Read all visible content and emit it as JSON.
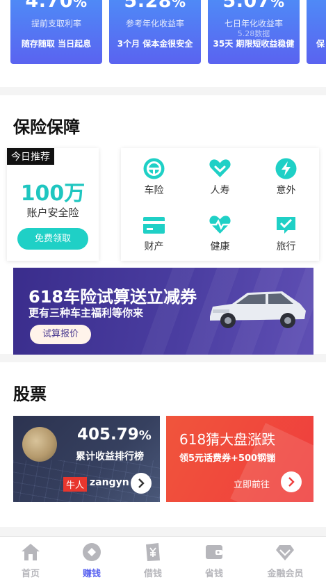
{
  "rates": [
    {
      "num": "4.70",
      "unit": "%",
      "label": "提前支取利率",
      "sub": "",
      "desc": "随存随取 当日起息"
    },
    {
      "num": "5.28",
      "unit": "%",
      "label": "参考年化收益率",
      "sub": "",
      "desc": "3个月 保本金很安全"
    },
    {
      "num": "5.07",
      "unit": "%",
      "label": "七日年化收益率",
      "sub": "5.28数据",
      "desc": "35天 期限短收益稳健"
    },
    {
      "num": "",
      "unit": "",
      "label": "",
      "sub": "",
      "desc": "保"
    }
  ],
  "insurance": {
    "title": "保险保障",
    "featured": {
      "tag": "今日推荐",
      "amount": "100万",
      "name": "账户安全险",
      "button": "免费领取"
    },
    "categories": [
      {
        "label": "车险",
        "icon": "steering-wheel-icon"
      },
      {
        "label": "人寿",
        "icon": "heart-icon"
      },
      {
        "label": "意外",
        "icon": "lightning-icon"
      },
      {
        "label": "财产",
        "icon": "card-icon"
      },
      {
        "label": "健康",
        "icon": "heart-pulse-icon"
      },
      {
        "label": "旅行",
        "icon": "check-flag-icon"
      }
    ],
    "banner": {
      "headline": "618车险试算送立减券",
      "subline": "更有三种车主福利等你来",
      "button": "试算报价"
    }
  },
  "stocks": {
    "title": "股票",
    "left": {
      "pct": "405.79",
      "unit": "%",
      "rank": "累计收益排行榜",
      "tag": "牛人",
      "user": "zangyn"
    },
    "right": {
      "title": "618猜大盘涨跌",
      "subtitle": "领5元话费券+500钢镚",
      "cta": "立即前往"
    }
  },
  "tabs": [
    {
      "label": "首页",
      "icon": "home-icon",
      "active": false
    },
    {
      "label": "赚钱",
      "icon": "coin-icon",
      "active": true
    },
    {
      "label": "借钱",
      "icon": "yen-book-icon",
      "active": false
    },
    {
      "label": "省钱",
      "icon": "wallet-icon",
      "active": false
    },
    {
      "label": "金融会员",
      "icon": "diamond-icon",
      "active": false
    }
  ],
  "colors": {
    "accent": "#5a63f0",
    "teal": "#1fc6c0",
    "red": "#ef3d3d",
    "inactive": "#b6b6bb"
  }
}
